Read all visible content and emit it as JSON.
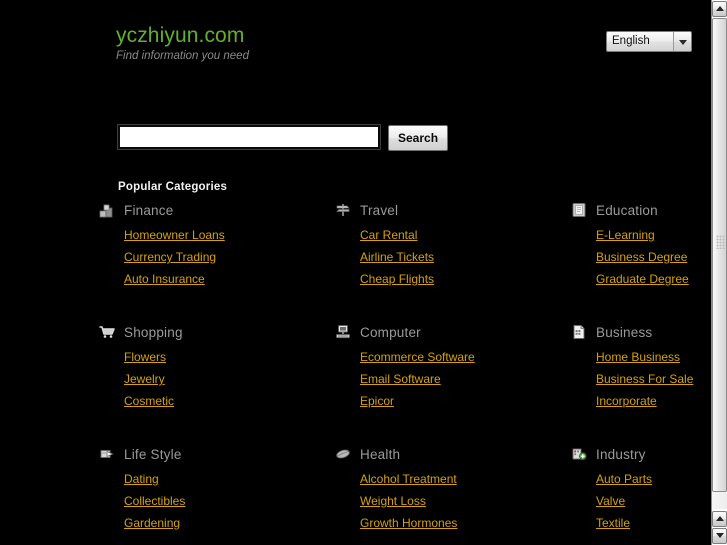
{
  "header": {
    "brand_name": "yczhiyun.com",
    "tagline": "Find information you need",
    "language_selected": "English",
    "language_options": [
      "English"
    ]
  },
  "search": {
    "value": "",
    "placeholder": "",
    "button_label": "Search"
  },
  "categories_section": {
    "title": "Popular Categories",
    "groups": [
      {
        "name": "Finance",
        "icon": "finance-blocks-icon",
        "links": [
          "Homeowner Loans",
          "Currency Trading",
          "Auto Insurance"
        ]
      },
      {
        "name": "Travel",
        "icon": "signpost-icon",
        "links": [
          "Car Rental",
          "Airline Tickets",
          "Cheap Flights"
        ]
      },
      {
        "name": "Education",
        "icon": "book-icon",
        "links": [
          "E-Learning",
          "Business Degree",
          "Graduate Degree"
        ]
      },
      {
        "name": "Shopping",
        "icon": "shopping-cart-icon",
        "links": [
          "Flowers",
          "Jewelry",
          "Cosmetic"
        ]
      },
      {
        "name": "Computer",
        "icon": "desktop-computer-icon",
        "links": [
          "Ecommerce Software",
          "Email Software",
          "Epicor"
        ]
      },
      {
        "name": "Business",
        "icon": "document-icon",
        "links": [
          "Home Business",
          "Business For Sale",
          "Incorporate"
        ]
      },
      {
        "name": "Life Style",
        "icon": "arrow-box-icon",
        "links": [
          "Dating",
          "Collectibles",
          "Gardening"
        ]
      },
      {
        "name": "Health",
        "icon": "leaf-icon",
        "links": [
          "Alcohol Treatment",
          "Weight Loss",
          "Growth Hormones"
        ]
      },
      {
        "name": "Industry",
        "icon": "factory-icon",
        "links": [
          "Auto Parts",
          "Valve",
          "Textile"
        ]
      }
    ]
  },
  "colors": {
    "background": "#000000",
    "brand": "#63b02f",
    "tagline": "#8a8a8a",
    "link": "#d4a206",
    "category_heading": "#9a9a9a",
    "section_title": "#f2f2f2"
  },
  "scrollbar": {
    "up_arrow": "scroll-up-arrow",
    "down_arrow": "scroll-down-arrow"
  }
}
